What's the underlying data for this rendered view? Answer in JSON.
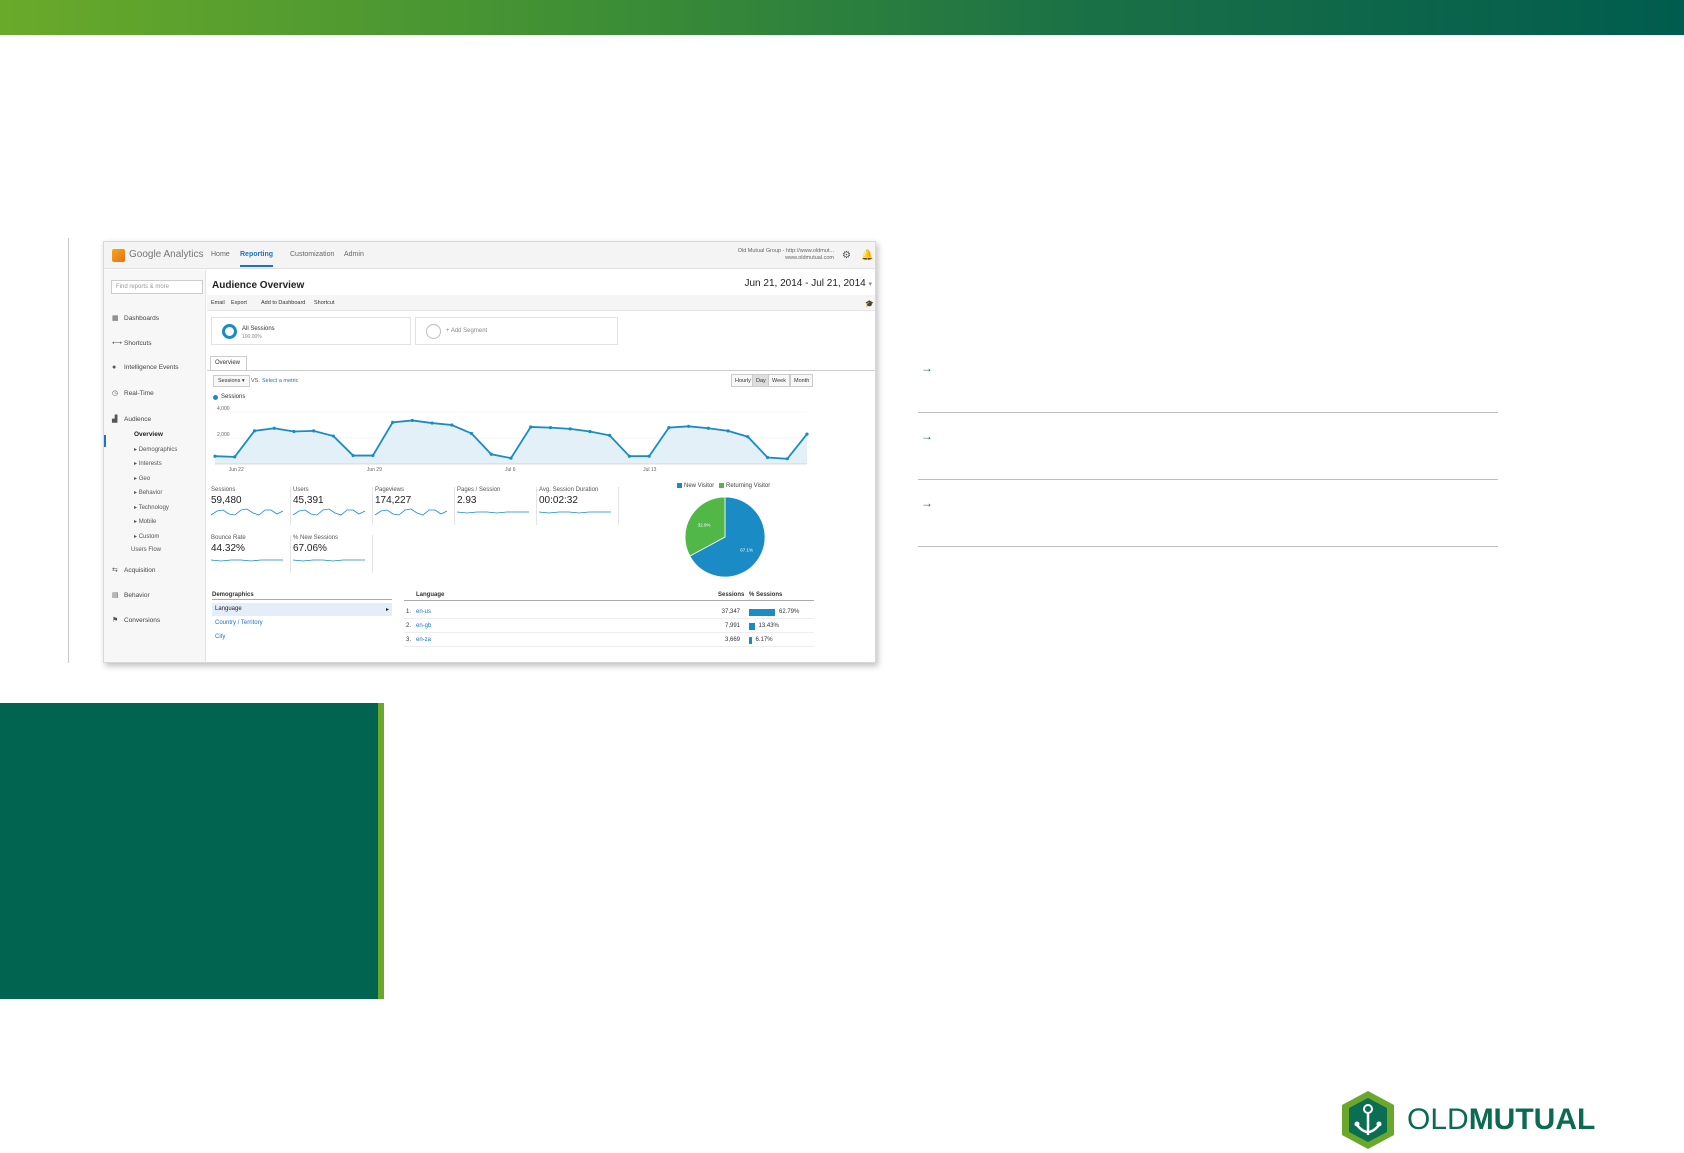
{
  "ga": {
    "brand": "Google Analytics",
    "nav": [
      "Home",
      "Reporting",
      "Customization",
      "Admin"
    ],
    "account_line1": "Old Mutual Group - http://www.oldmut...",
    "account_line2": "www.oldmutual.com",
    "search_placeholder": "Find reports & more",
    "sidebar": {
      "items": [
        {
          "icon": "grid-icon",
          "label": "Dashboards"
        },
        {
          "icon": "shortcut-icon",
          "label": "Shortcuts"
        },
        {
          "icon": "lightbulb-icon",
          "label": "Intelligence Events"
        },
        {
          "icon": "clock-icon",
          "label": "Real-Time"
        },
        {
          "icon": "people-icon",
          "label": "Audience"
        }
      ],
      "audience_sub": [
        "Overview",
        "Demographics",
        "Interests",
        "Geo",
        "Behavior",
        "Technology",
        "Mobile",
        "Custom",
        "Users Flow"
      ],
      "items2": [
        {
          "icon": "acquisition-icon",
          "label": "Acquisition"
        },
        {
          "icon": "behavior-icon",
          "label": "Behavior"
        },
        {
          "icon": "flag-icon",
          "label": "Conversions"
        }
      ]
    },
    "title": "Audience Overview",
    "date_range": "Jun 21, 2014 - Jul 21, 2014",
    "toolbar": [
      "Email",
      "Export",
      "Add to Dashboard",
      "Shortcut"
    ],
    "segments": {
      "all": "All Sessions",
      "all_pct": "100.00%",
      "add": "+ Add Segment"
    },
    "tab": "Overview",
    "metric_select": "Sessions",
    "vs": "VS.",
    "select_metric": "Select a metric",
    "granularity": [
      "Hourly",
      "Day",
      "Week",
      "Month"
    ],
    "granularity_active": "Day",
    "series_legend": "Sessions",
    "colors": {
      "primary": "#1a8bc4",
      "secondary": "#51b848",
      "link": "#1a73c8"
    }
  },
  "chart_data": {
    "type": "area",
    "series": [
      {
        "name": "Sessions",
        "values": [
          600,
          550,
          2550,
          2750,
          2500,
          2550,
          2150,
          650,
          650,
          3200,
          3350,
          3150,
          3000,
          2350,
          750,
          450,
          2850,
          2800,
          2700,
          2500,
          2200,
          600,
          600,
          2800,
          2900,
          2750,
          2550,
          2100,
          500,
          400,
          2300
        ]
      }
    ],
    "x_ticks": [
      "Jun 22",
      "Jun 29",
      "Jul 6",
      "Jul 13"
    ],
    "y_ticks": [
      "4,000",
      "2,000"
    ],
    "ylim": [
      0,
      4000
    ]
  },
  "metrics": [
    {
      "label": "Sessions",
      "value": "59,480"
    },
    {
      "label": "Users",
      "value": "45,391"
    },
    {
      "label": "Pageviews",
      "value": "174,227"
    },
    {
      "label": "Pages / Session",
      "value": "2.93"
    },
    {
      "label": "Avg. Session Duration",
      "value": "00:02:32"
    },
    {
      "label": "Bounce Rate",
      "value": "44.32%"
    },
    {
      "label": "% New Sessions",
      "value": "67.06%"
    }
  ],
  "pie": {
    "legend": [
      "New Visitor",
      "Returning Visitor"
    ],
    "values": [
      67.1,
      32.9
    ],
    "labels": [
      "67.1%",
      "32.9%"
    ]
  },
  "demographics": {
    "header": "Demographics",
    "rows": [
      "Language",
      "Country / Territory",
      "City"
    ]
  },
  "language_table": {
    "headers": [
      "Language",
      "Sessions",
      "% Sessions"
    ],
    "rows": [
      {
        "rank": "1.",
        "lang": "en-us",
        "sessions": "37,347",
        "pct": "62.79%",
        "bar": 62.79
      },
      {
        "rank": "2.",
        "lang": "en-gb",
        "sessions": "7,991",
        "pct": "13.43%",
        "bar": 13.43
      },
      {
        "rank": "3.",
        "lang": "en-za",
        "sessions": "3,669",
        "pct": "6.17%",
        "bar": 6.17
      }
    ]
  },
  "bullets": [
    "→",
    "→",
    "→"
  ],
  "logo": {
    "part1": "OLD",
    "part2": "MUTUAL"
  }
}
